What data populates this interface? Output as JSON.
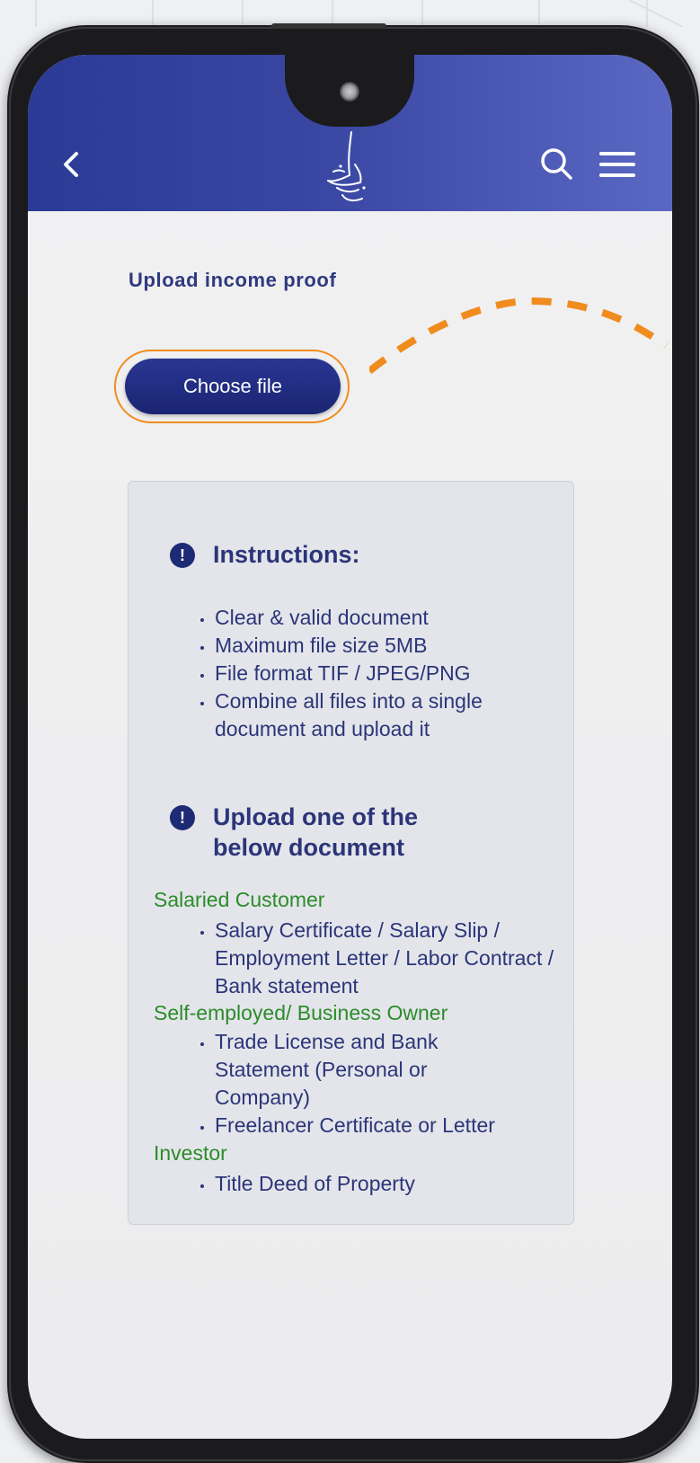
{
  "header": {
    "back_icon": "chevron-left-icon",
    "logo_icon": "calligraphy-logo-icon",
    "search_icon": "search-icon",
    "menu_icon": "hamburger-menu-icon",
    "bar_color": "#2a3a95"
  },
  "upload": {
    "title": "Upload income proof",
    "choose_label": "Choose file",
    "highlight_color": "#f08c1e"
  },
  "instructions": {
    "title": "Instructions:",
    "items": [
      "Clear & valid document",
      "Maximum file size 5MB",
      "File format TIF / JPEG/PNG",
      "Combine all files into a single document and upload it"
    ]
  },
  "documents": {
    "title": "Upload one of the below document",
    "groups": [
      {
        "category": "Salaried Customer",
        "items": [
          "Salary Certificate / Salary Slip / Employment Letter / Labor Contract / Bank statement"
        ]
      },
      {
        "category": "Self-employed/ Business Owner",
        "items": [
          "Trade License and Bank Statement (Personal or Company)",
          "Freelancer Certificate or Letter"
        ]
      },
      {
        "category": "Investor",
        "items": [
          "Title Deed of Property"
        ]
      }
    ]
  }
}
